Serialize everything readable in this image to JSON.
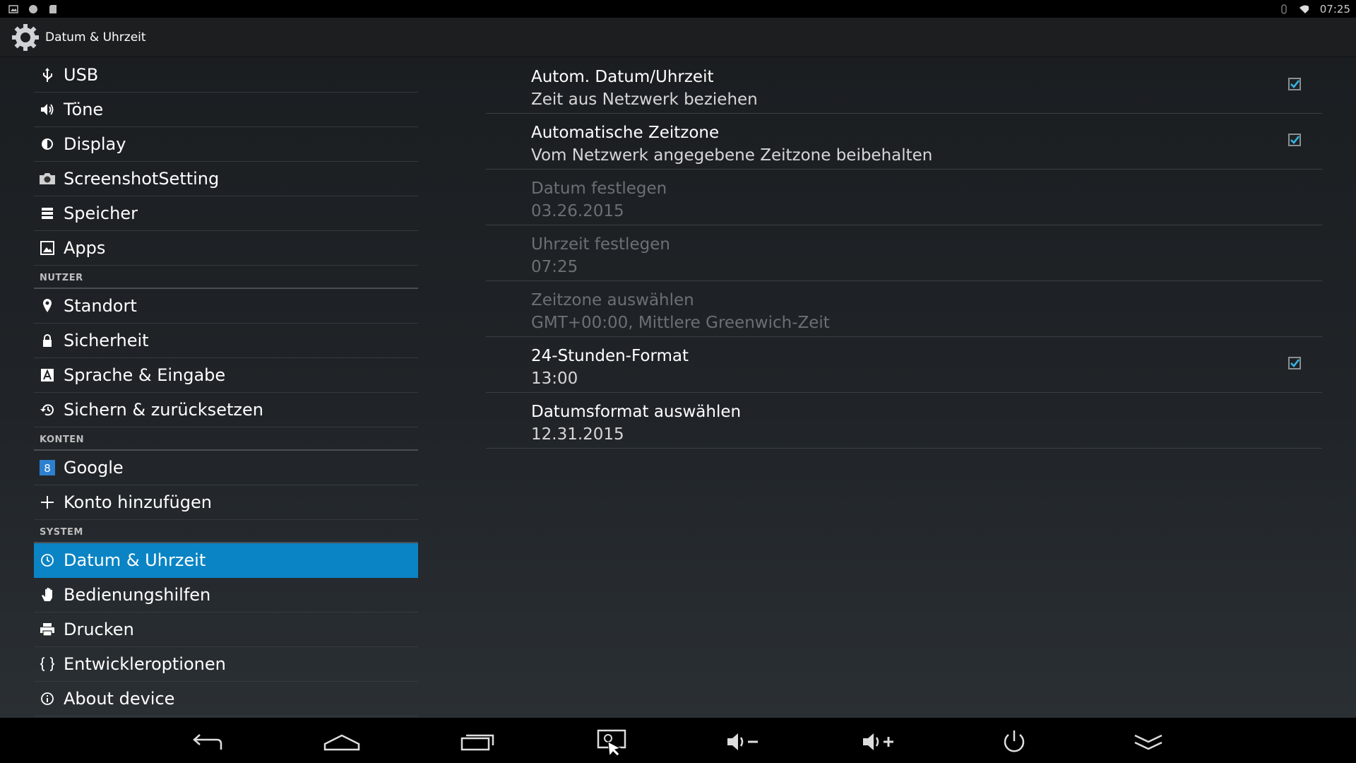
{
  "status_bar": {
    "time": "07:25"
  },
  "header": {
    "title": "Datum & Uhrzeit"
  },
  "sidebar": {
    "groups": [
      {
        "section": "",
        "items": [
          {
            "label": "USB",
            "icon": "usb-icon"
          },
          {
            "label": "Töne",
            "icon": "speaker-icon"
          },
          {
            "label": "Display",
            "icon": "brightness-icon"
          },
          {
            "label": "ScreenshotSetting",
            "icon": "camera-icon"
          },
          {
            "label": "Speicher",
            "icon": "storage-icon"
          },
          {
            "label": "Apps",
            "icon": "apps-icon"
          }
        ]
      },
      {
        "section": "NUTZER",
        "items": [
          {
            "label": "Standort",
            "icon": "location-icon"
          },
          {
            "label": "Sicherheit",
            "icon": "lock-icon"
          },
          {
            "label": "Sprache & Eingabe",
            "icon": "language-icon"
          },
          {
            "label": "Sichern & zurücksetzen",
            "icon": "restore-icon"
          }
        ]
      },
      {
        "section": "KONTEN",
        "items": [
          {
            "label": "Google",
            "icon": "google-icon"
          },
          {
            "label": "Konto hinzufügen",
            "icon": "plus-icon"
          }
        ]
      },
      {
        "section": "SYSTEM",
        "items": [
          {
            "label": "Datum & Uhrzeit",
            "icon": "clock-icon",
            "active": true
          },
          {
            "label": "Bedienungshilfen",
            "icon": "hand-icon"
          },
          {
            "label": "Drucken",
            "icon": "printer-icon"
          },
          {
            "label": "Entwickleroptionen",
            "icon": "braces-icon"
          },
          {
            "label": "About device",
            "icon": "info-icon"
          }
        ]
      }
    ]
  },
  "settings": [
    {
      "title": "Autom. Datum/Uhrzeit",
      "summary": "Zeit aus Netzwerk beziehen",
      "checkbox": true,
      "checked": true,
      "enabled": true
    },
    {
      "title": "Automatische Zeitzone",
      "summary": "Vom Netzwerk angegebene Zeitzone beibehalten",
      "checkbox": true,
      "checked": true,
      "enabled": true
    },
    {
      "title": "Datum festlegen",
      "summary": "03.26.2015",
      "checkbox": false,
      "enabled": false
    },
    {
      "title": "Uhrzeit festlegen",
      "summary": "07:25",
      "checkbox": false,
      "enabled": false
    },
    {
      "title": "Zeitzone auswählen",
      "summary": "GMT+00:00, Mittlere Greenwich-Zeit",
      "checkbox": false,
      "enabled": false
    },
    {
      "title": "24-Stunden-Format",
      "summary": "13:00",
      "checkbox": true,
      "checked": true,
      "enabled": true
    },
    {
      "title": "Datumsformat auswählen",
      "summary": "12.31.2015",
      "checkbox": false,
      "enabled": true
    }
  ],
  "navbar": [
    "back-icon",
    "home-icon",
    "recents-icon",
    "screenshot-icon",
    "volume-down-icon",
    "volume-up-icon",
    "power-icon",
    "collapse-icon"
  ],
  "colors": {
    "accent": "#0a84c4",
    "check": "#33b5e5"
  }
}
